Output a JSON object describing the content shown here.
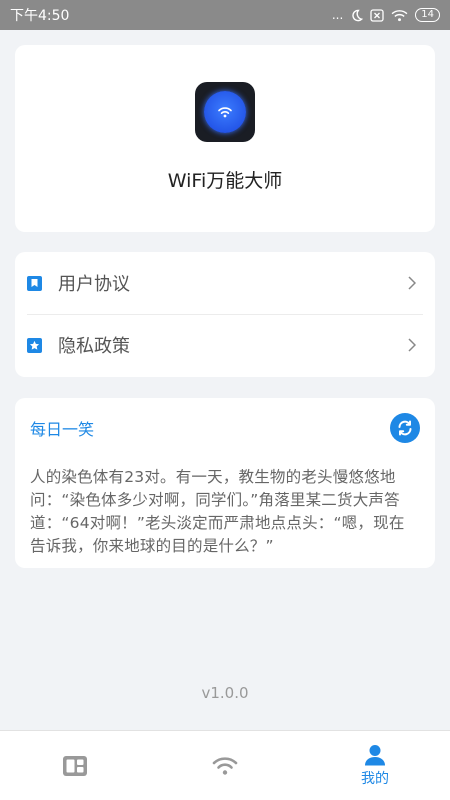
{
  "status_bar": {
    "time": "下午4:50",
    "dots": "...",
    "battery": "14"
  },
  "app": {
    "name": "WiFi万能大师",
    "icon": "wifi-app-icon"
  },
  "menu": [
    {
      "label": "用户协议",
      "icon": "bookmark-icon"
    },
    {
      "label": "隐私政策",
      "icon": "star-icon"
    }
  ],
  "joke": {
    "title": "每日一笑",
    "text": "人的染色体有23对。有一天，教生物的老头慢悠悠地问：“染色体多少对啊，同学们。”角落里某二货大声答道：“64对啊！”老头淡定而严肃地点点头：“嗯，现在告诉我，你来地球的目的是什么？”"
  },
  "version": "v1.0.0",
  "nav": {
    "tabs": [
      {
        "icon": "dashboard-icon",
        "label": ""
      },
      {
        "icon": "wifi-icon",
        "label": ""
      },
      {
        "icon": "user-icon",
        "label": "我的",
        "active": true
      }
    ]
  },
  "colors": {
    "accent": "#1e88e5",
    "background": "#f1f3f6",
    "inactive_icon": "#999999"
  }
}
